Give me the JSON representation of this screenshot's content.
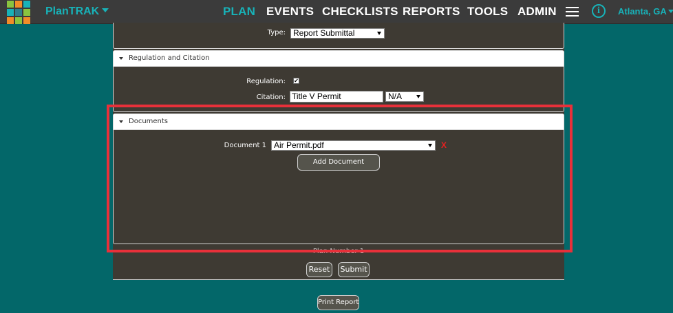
{
  "app": {
    "brand": "PlanTRAK",
    "location": "Atlanta, GA"
  },
  "nav": {
    "items": [
      "PLAN",
      "EVENTS",
      "CHECKLISTS",
      "REPORTS",
      "TOOLS",
      "ADMIN"
    ],
    "active": "PLAN"
  },
  "type_row": {
    "label": "Type:",
    "value": "Report Submittal"
  },
  "regulation_section": {
    "title": "Regulation and Citation",
    "regulation_label": "Regulation:",
    "regulation_checked": true,
    "regulation_mark": "✔",
    "citation_label": "Citation:",
    "citation_value": "Title V Permit",
    "citation_select": "N/A"
  },
  "documents_section": {
    "title": "Documents",
    "document_label": "Document 1",
    "document_value": "Air Permit.pdf",
    "remove_label": "X",
    "add_button": "Add Document"
  },
  "plan_number": "Plan Number 1",
  "actions": {
    "reset": "Reset",
    "submit": "Submit",
    "print": "Print Report"
  },
  "colors": {
    "page_bg": "#036769",
    "topbar_bg": "#3b3b3b",
    "accent": "#18b2b8",
    "panel_bg": "#3e3a33",
    "highlight": "#e8303a",
    "remove": "#e62020"
  },
  "icons": {
    "logo": "plantrak-logo",
    "menu": "hamburger-icon",
    "info": "info-icon"
  }
}
